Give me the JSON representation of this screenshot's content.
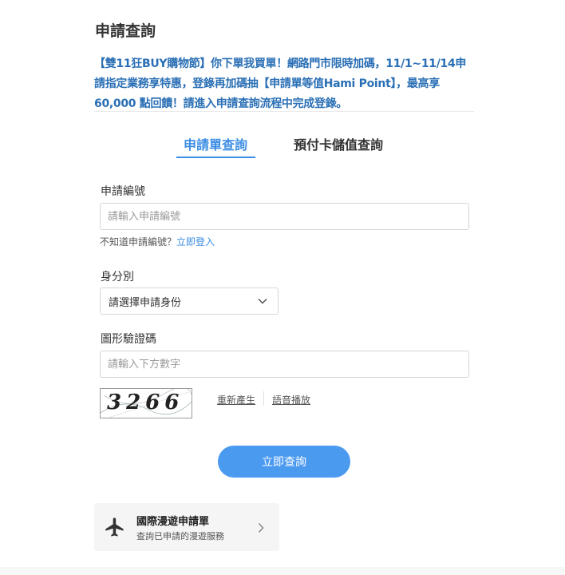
{
  "page": {
    "title": "申請查詢",
    "promo": "【雙11狂BUY購物節】你下單我買單！網路門市限時加碼，11/1~11/14申請指定業務享特惠，登錄再加碼抽【申請單等值Hami Point】，最高享60,000 點回饋！請進入申請查詢流程中完成登錄。"
  },
  "tabs": [
    {
      "label": "申請單查詢",
      "active": true
    },
    {
      "label": "預付卡儲值查詢",
      "active": false
    }
  ],
  "form": {
    "application_no": {
      "label": "申請編號",
      "placeholder": "請輸入申請編號",
      "value": ""
    },
    "hint": {
      "text": "不知道申請編號？",
      "link": "立即登入"
    },
    "identity": {
      "label": "身分別",
      "selected": "請選擇申請身份"
    },
    "captcha": {
      "label": "圖形驗證碼",
      "placeholder": "請輸入下方數字",
      "value": "",
      "image_text": "3266",
      "regenerate": "重新產生",
      "audio": "語音播放"
    },
    "submit_label": "立即查詢"
  },
  "roaming_card": {
    "icon": "airplane-icon",
    "title": "國際漫遊申請單",
    "subtitle": "查詢已申請的漫遊服務",
    "chevron": "chevron-right-icon"
  },
  "colors": {
    "accent": "#3c8ee4",
    "button": "#4a9af0",
    "promo_text": "#2a6fb5"
  }
}
